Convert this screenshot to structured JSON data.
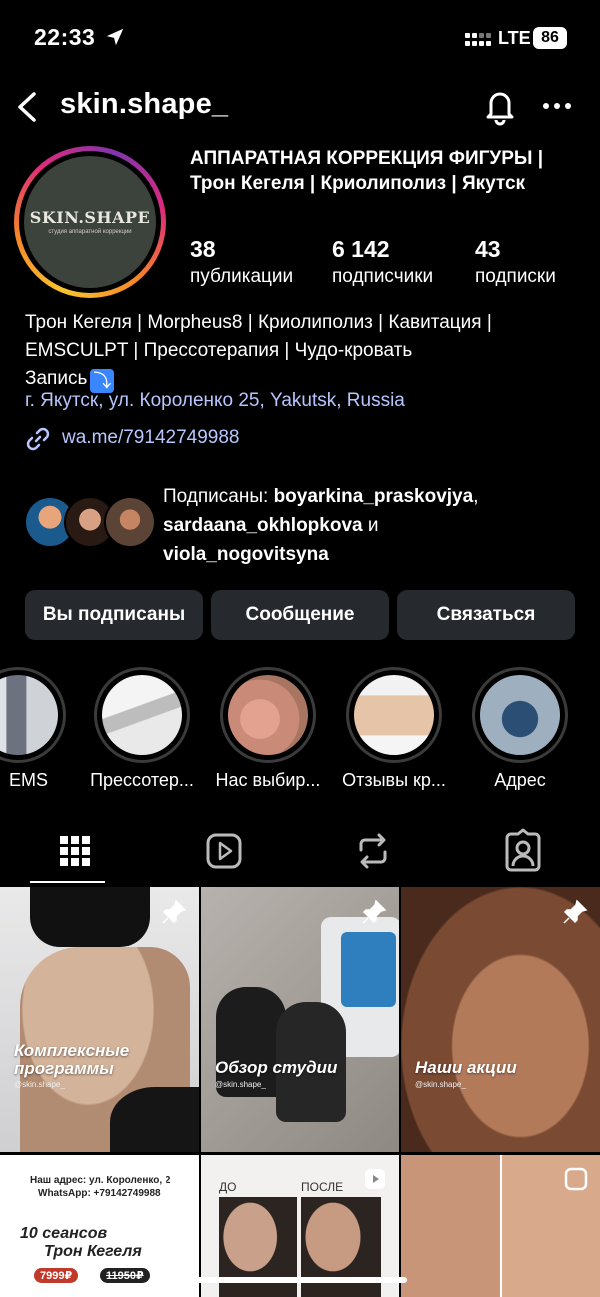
{
  "status_bar": {
    "time": "22:33",
    "network": "LTE",
    "battery": "86"
  },
  "header": {
    "handle": "skin.shape_"
  },
  "avatar": {
    "logo_main": "SKIN.SHAPE",
    "logo_sub": "студия аппаратной коррекции"
  },
  "profile": {
    "title": "АППАРАТНАЯ КОРРЕКЦИЯ ФИГУРЫ | Трон Кегеля | Криолиполиз | Якутск",
    "stats": [
      {
        "value": "38",
        "label": "публикации"
      },
      {
        "value": "6 142",
        "label": "подписчики"
      },
      {
        "value": "43",
        "label": "подписки"
      }
    ],
    "bio_line1": "Трон Кегеля | Morpheus8 | Криолиполиз | Кавитация | EMSCULPT | Прессотерапия | Чудо-кровать",
    "bio_line2": "Запись",
    "bio_emoji": "⤵",
    "address": "г. Якутск, ул. Короленко 25, Yakutsk, Russia",
    "link": "wa.me/79142749988"
  },
  "followed_by": {
    "prefix": "Подписаны:",
    "user1": "boyarkina_praskovjya",
    "user2": "sardaana_okhlopkova",
    "conj": "и",
    "user3": "viola_nogovitsyna"
  },
  "actions": {
    "following": "Вы подписаны",
    "message": "Сообщение",
    "contact": "Связаться"
  },
  "highlights": [
    {
      "label": "EMS"
    },
    {
      "label": "Прессотер..."
    },
    {
      "label": "Нас выбир..."
    },
    {
      "label": "Отзывы кр..."
    },
    {
      "label": "Адрес"
    }
  ],
  "grid": {
    "tile1": {
      "caption": "Комплексные программы",
      "sub": "@skin.shape_"
    },
    "tile2": {
      "caption": "Обзор студии",
      "sub": "@skin.shape_"
    },
    "tile3": {
      "caption": "Наши акции",
      "sub": "@skin.shape_"
    },
    "tile4": {
      "line1": "Наш адрес: ул. Короленко, 2",
      "line2": "WhatsApp: +79142749988",
      "title1": "10 сеансов",
      "title2": "Трон Кегеля",
      "price_new": "7999₽",
      "price_old": "11950₽"
    },
    "tile5": {
      "before": "ДО",
      "after": "ПОСЛЕ"
    }
  },
  "colors": {
    "link": "#b8c6ff",
    "button_bg": "#262a2f",
    "background": "#000000"
  }
}
